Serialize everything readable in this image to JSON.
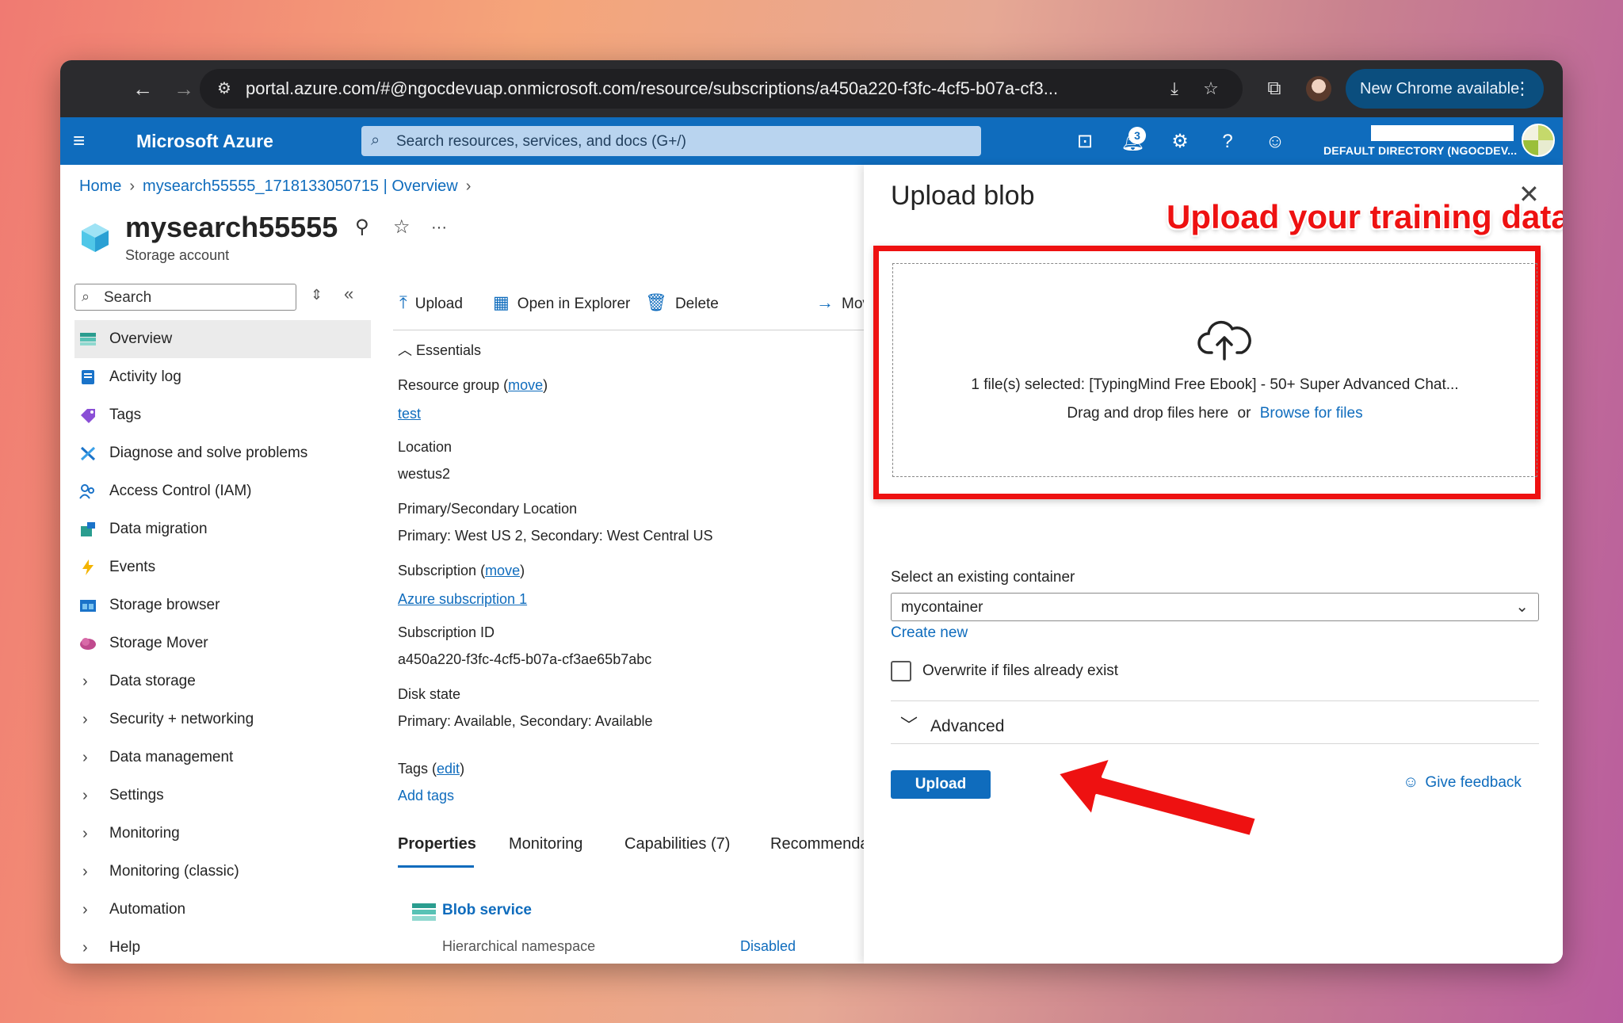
{
  "browser": {
    "url": "portal.azure.com/#@ngocdevuap.onmicrosoft.com/resource/subscriptions/a450a220-f3fc-4cf5-b07a-cf3...",
    "new_chrome": "New Chrome available"
  },
  "azure": {
    "brand": "Microsoft Azure",
    "search_placeholder": "Search resources, services, and docs (G+/)",
    "notification_count": "3",
    "directory": "DEFAULT DIRECTORY (NGOCDEV..."
  },
  "breadcrumb": [
    "Home",
    "mysearch55555_1718133050715 | Overview"
  ],
  "resource": {
    "name": "mysearch55555",
    "type": "Storage account",
    "more": "···"
  },
  "sidebar": {
    "search_placeholder": "Search",
    "items": [
      {
        "label": "Overview",
        "icon": "overview-icon"
      },
      {
        "label": "Activity log",
        "icon": "activity-log-icon"
      },
      {
        "label": "Tags",
        "icon": "tag-icon"
      },
      {
        "label": "Diagnose and solve problems",
        "icon": "wrench-icon"
      },
      {
        "label": "Access Control (IAM)",
        "icon": "people-icon"
      },
      {
        "label": "Data migration",
        "icon": "migration-icon"
      },
      {
        "label": "Events",
        "icon": "lightning-icon"
      },
      {
        "label": "Storage browser",
        "icon": "storage-browser-icon"
      },
      {
        "label": "Storage Mover",
        "icon": "cloud-mover-icon"
      },
      {
        "label": "Data storage"
      },
      {
        "label": "Security + networking"
      },
      {
        "label": "Data management"
      },
      {
        "label": "Settings"
      },
      {
        "label": "Monitoring"
      },
      {
        "label": "Monitoring (classic)"
      },
      {
        "label": "Automation"
      },
      {
        "label": "Help"
      }
    ]
  },
  "toolbar": {
    "upload": "Upload",
    "open_explorer": "Open in Explorer",
    "delete": "Delete",
    "move": "Move"
  },
  "essentials": {
    "header": "Essentials",
    "resource_group_label": "Resource group",
    "move": "move",
    "resource_group_value": "test",
    "location_label": "Location",
    "location_value": "westus2",
    "primary_secondary_label": "Primary/Secondary Location",
    "primary_secondary_value": "Primary: West US 2, Secondary: West Central US",
    "subscription_label": "Subscription",
    "subscription_value": "Azure subscription 1",
    "subscription_id_label": "Subscription ID",
    "subscription_id_value": "a450a220-f3fc-4cf5-b07a-cf3ae65b7abc",
    "disk_state_label": "Disk state",
    "disk_state_value": "Primary: Available, Secondary: Available",
    "tags_label": "Tags",
    "edit": "edit",
    "add_tags": "Add tags"
  },
  "tabs": [
    "Properties",
    "Monitoring",
    "Capabilities (7)",
    "Recommenda"
  ],
  "blob_service": {
    "title": "Blob service",
    "hns_label": "Hierarchical namespace",
    "hns_value": "Disabled"
  },
  "upload_panel": {
    "title": "Upload blob",
    "annotation": "Upload your training data",
    "selected": "1 file(s) selected: [TypingMind Free Ebook] - 50+ Super Advanced Chat...",
    "drag_text": "Drag and drop files here",
    "or": "or",
    "browse": "Browse for files",
    "container_label": "Select an existing container",
    "container_value": "mycontainer",
    "create_new": "Create new",
    "overwrite_label": "Overwrite if files already exist",
    "advanced": "Advanced",
    "upload_button": "Upload",
    "feedback": "Give feedback"
  }
}
